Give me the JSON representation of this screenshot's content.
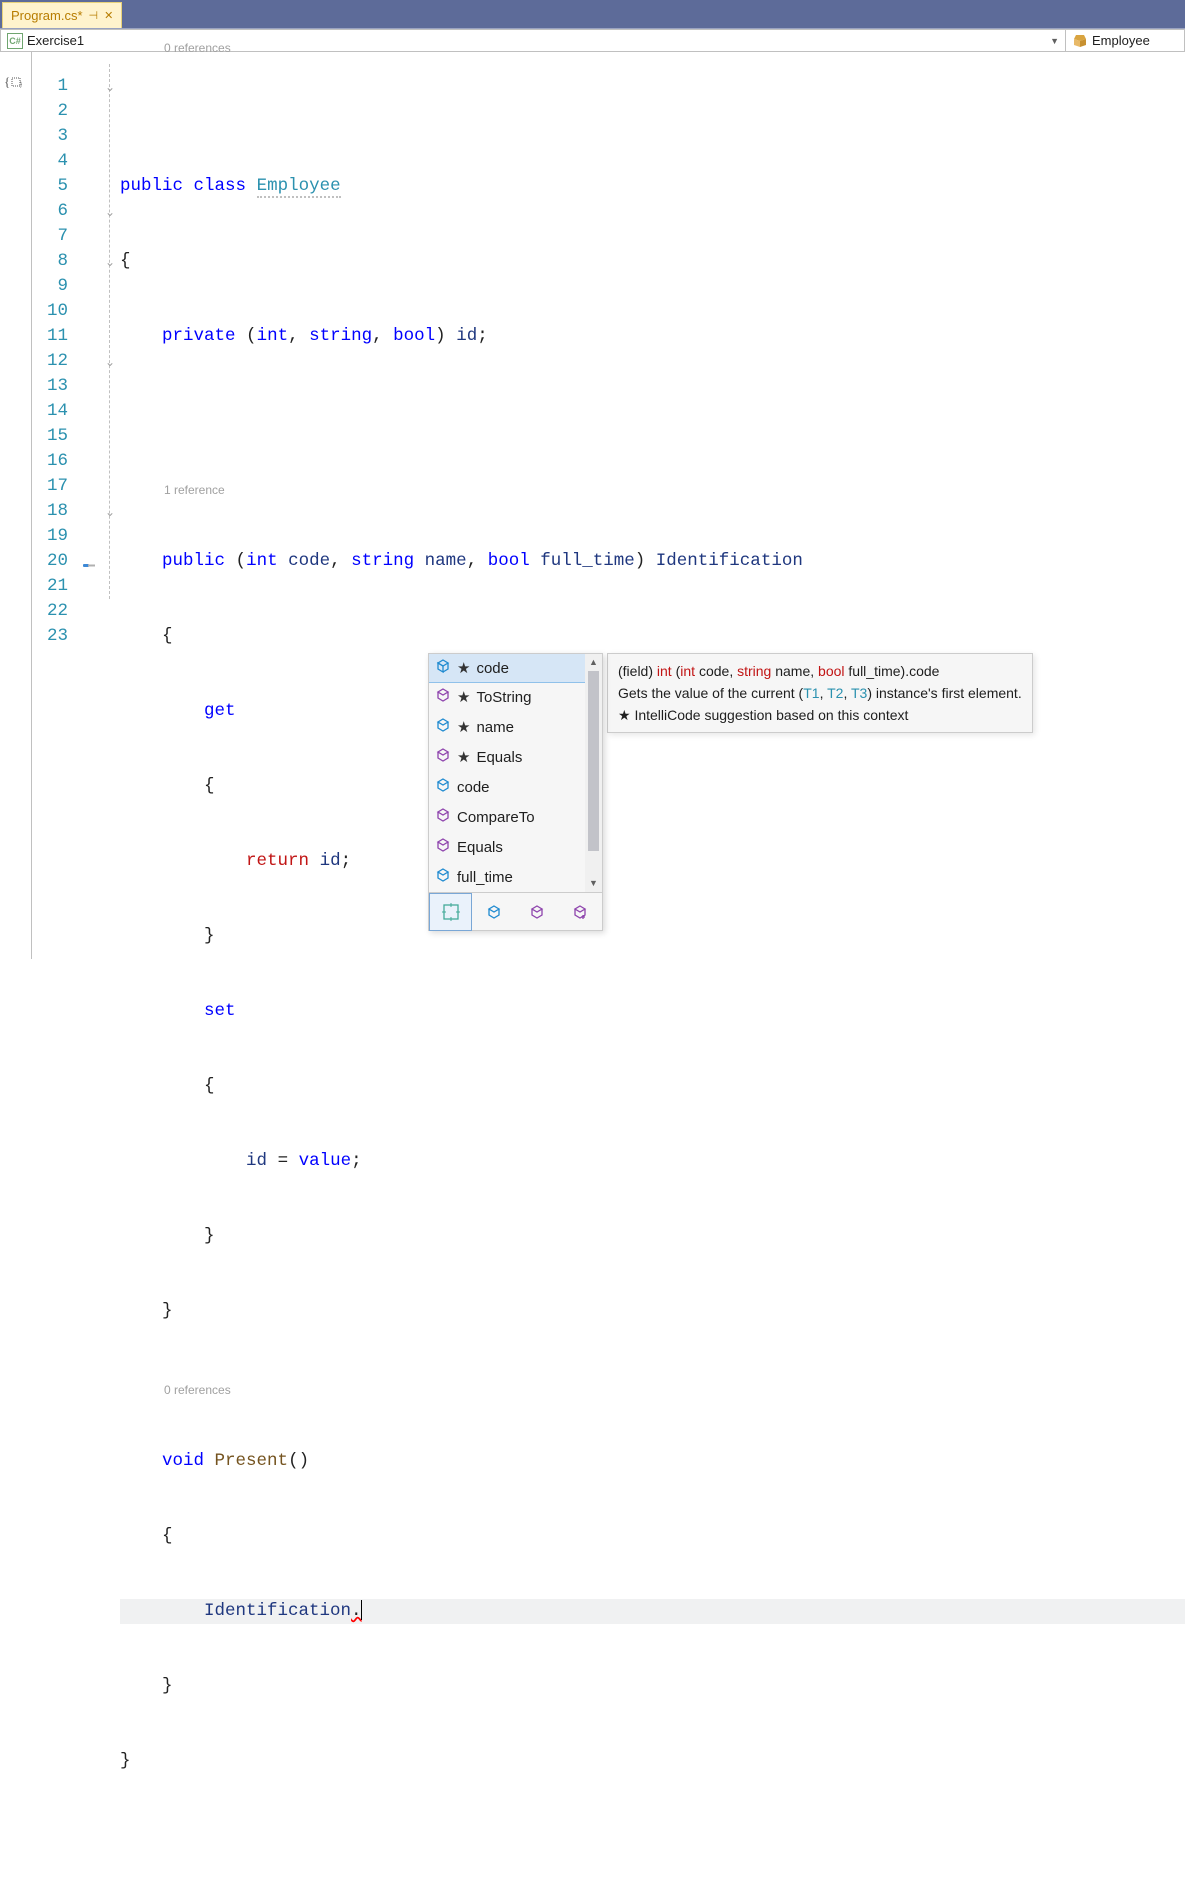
{
  "tab": {
    "title": "Program.cs*",
    "pin_glyph": "⊣",
    "close_glyph": "✕"
  },
  "navbar": {
    "left_icon_text": "C#",
    "left_text": "Exercise1",
    "right_text": "Employee"
  },
  "gutter": {
    "outline_glyph": "{ }",
    "lines": [
      "1",
      "2",
      "3",
      "4",
      "5",
      "6",
      "7",
      "8",
      "9",
      "10",
      "11",
      "12",
      "13",
      "14",
      "15",
      "16",
      "17",
      "18",
      "19",
      "20",
      "21",
      "22",
      "23"
    ]
  },
  "annotations": {
    "refs0": "0 references",
    "refs1": "1 reference",
    "refs2": "0 references"
  },
  "code": {
    "l1": {
      "a": "public",
      "b": "class",
      "c": "Employee"
    },
    "l2": "{",
    "l3": {
      "a": "private",
      "b": "(",
      "c": "int",
      "d": ",",
      "e": "string",
      "f": ",",
      "g": "bool",
      "h": ")",
      "i": "id",
      "j": ";"
    },
    "l6": {
      "a": "public",
      "b": "(",
      "c": "int",
      "d": "code",
      "e": ",",
      "f": "string",
      "g": "name",
      "h": ",",
      "i": "bool",
      "j": "full_time",
      "k": ")",
      "l": "Identification"
    },
    "l7": "{",
    "l8": "get",
    "l9": "{",
    "l10": {
      "a": "return",
      "b": "id",
      "c": ";"
    },
    "l11": "}",
    "l12": "set",
    "l13": "{",
    "l14": {
      "a": "id",
      "b": "=",
      "c": "value",
      "d": ";"
    },
    "l15": "}",
    "l16": "}",
    "l18": {
      "a": "void",
      "b": "Present",
      "c": "()"
    },
    "l19": "{",
    "l20": {
      "a": "Identification",
      "b": "."
    },
    "l21": "}",
    "l22": "}"
  },
  "intellisense": {
    "items": [
      {
        "icon": "field",
        "star": true,
        "label": "code",
        "selected": true
      },
      {
        "icon": "method",
        "star": true,
        "label": "ToString"
      },
      {
        "icon": "field",
        "star": true,
        "label": "name"
      },
      {
        "icon": "method",
        "star": true,
        "label": "Equals"
      },
      {
        "icon": "field",
        "star": false,
        "label": "code"
      },
      {
        "icon": "method",
        "star": false,
        "label": "CompareTo"
      },
      {
        "icon": "method",
        "star": false,
        "label": "Equals"
      },
      {
        "icon": "field",
        "star": false,
        "label": "full_time"
      }
    ]
  },
  "tooltip": {
    "sig_prefix": "(field) ",
    "sig_int": "int",
    "sig_open": " (",
    "sig_p1t": "int",
    "sig_p1n": " code",
    "sig_c1": ", ",
    "sig_p2t": "string",
    "sig_p2n": " name",
    "sig_c2": ", ",
    "sig_p3t": "bool",
    "sig_p3n": " full_time",
    "sig_close": ").code",
    "line2a": "Gets the value of the current (",
    "line2t1": "T1",
    "line2c1": ", ",
    "line2t2": "T2",
    "line2c2": ", ",
    "line2t3": "T3",
    "line2b": ") instance's first element.",
    "line3": "★  IntelliCode suggestion based on this context"
  }
}
